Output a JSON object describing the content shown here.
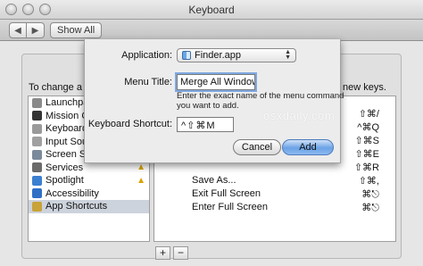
{
  "window": {
    "title": "Keyboard"
  },
  "toolbar": {
    "back_icon": "chevron-left-icon",
    "forward_icon": "chevron-right-icon",
    "show_all_label": "Show All"
  },
  "pane": {
    "instructions_start": "To change a s",
    "instructions_end": "new keys."
  },
  "categories": [
    {
      "label": "Launchpa",
      "icon": "launchpad-icon",
      "color": "#8a8a8a"
    },
    {
      "label": "Mission C",
      "icon": "mission-control-icon",
      "color": "#333333"
    },
    {
      "label": "Keyboard",
      "icon": "keyboard-icon",
      "color": "#9a9a9a"
    },
    {
      "label": "Input Sou",
      "icon": "input-sources-icon",
      "color": "#a0a0a0"
    },
    {
      "label": "Screen Sh",
      "icon": "screen-shots-icon",
      "color": "#7b8a9a"
    },
    {
      "label": "Services",
      "icon": "services-icon",
      "color": "#6b6b6b",
      "warning": true
    },
    {
      "label": "Spotlight",
      "icon": "spotlight-icon",
      "color": "#3b7fd1",
      "warning": true
    },
    {
      "label": "Accessibility",
      "icon": "accessibility-icon",
      "color": "#2f6fc6"
    },
    {
      "label": "App Shortcuts",
      "icon": "app-shortcuts-icon",
      "color": "#c9a23a",
      "selected": true
    }
  ],
  "shortcuts": [
    {
      "name": "",
      "key": "⇧⌘/"
    },
    {
      "name": "",
      "key": "^⌘Q"
    },
    {
      "name": "",
      "key": "⇧⌘S"
    },
    {
      "name": "",
      "key": "⇧⌘E"
    },
    {
      "name": "",
      "key": "⇧⌘R"
    },
    {
      "name": "Save As...",
      "key": "⇧⌘,"
    },
    {
      "name": "Exit Full Screen",
      "key": "⌘⎋"
    },
    {
      "name": "Enter Full Screen",
      "key": "⌘⎋"
    }
  ],
  "bottom_buttons": {
    "add_label": "+",
    "remove_label": "−"
  },
  "sheet": {
    "application_label": "Application:",
    "application_value": "Finder.app",
    "menu_title_label": "Menu Title:",
    "menu_title_value": "Merge All Windows",
    "help_text_line1": "Enter the exact name of the menu command",
    "help_text_line2": "you want to add.",
    "keyboard_shortcut_label": "Keyboard Shortcut:",
    "keyboard_shortcut_value": "^⇧⌘M",
    "cancel_label": "Cancel",
    "add_label": "Add"
  },
  "watermark": "osxdaily.com"
}
